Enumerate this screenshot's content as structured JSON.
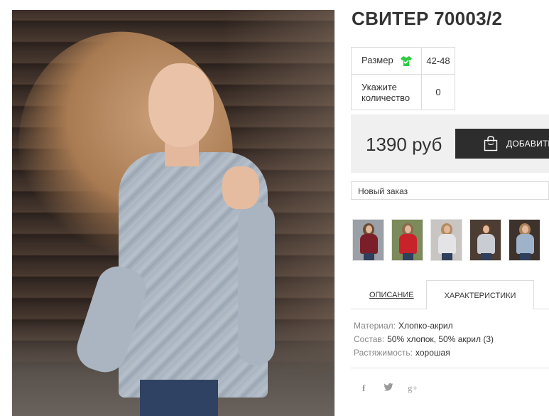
{
  "product": {
    "title": "СВИТЕР 70003/2",
    "main_image": "model-in-grey-cold-shoulder-sweater"
  },
  "specs": {
    "rows": [
      {
        "label": "Размер",
        "value": "42-48",
        "icon": "tshirt-icon"
      },
      {
        "label": "Укажите количество",
        "value": "0"
      }
    ]
  },
  "purchase": {
    "price": "1390 руб",
    "add_button_label": "ДОБАВИТЬ",
    "button_icon": "shopping-bag-icon",
    "order_select_value": "Новый заказ"
  },
  "thumbnails": [
    {
      "name": "thumb-burgundy",
      "color": "#7a1f2a",
      "hair": "#6b4a32",
      "bg": "#9aa0a6"
    },
    {
      "name": "thumb-red",
      "color": "#c8222b",
      "hair": "#8a6a4a",
      "bg": "#7c8a5c"
    },
    {
      "name": "thumb-white",
      "color": "#e4e4e6",
      "hair": "#b38a5e",
      "bg": "#c8c5c2"
    },
    {
      "name": "thumb-grey-stripe",
      "color": "#c9ccd2",
      "hair": "#5a3e2a",
      "bg": "#4b3c34"
    },
    {
      "name": "thumb-blue-grey",
      "color": "#9eb3c9",
      "hair": "#a9825c",
      "bg": "#3e322c"
    }
  ],
  "tabs": {
    "description": "ОПИСАНИЕ",
    "characteristics": "ХАРАКТЕРИСТИКИ",
    "active": "characteristics"
  },
  "characteristics": [
    {
      "key": "Материал:",
      "value": "Хлопко-акрил"
    },
    {
      "key": "Состав:",
      "value": "50% хлопок, 50% акрил (3)"
    },
    {
      "key": "Растяжимость:",
      "value": "хорошая"
    }
  ],
  "social": {
    "facebook": "f",
    "twitter": "🐦",
    "google_plus": "g+"
  },
  "colors": {
    "button_bg": "#2d2d2d",
    "price_box_bg": "#f0f0f0",
    "icon_green": "#2ecc40"
  }
}
